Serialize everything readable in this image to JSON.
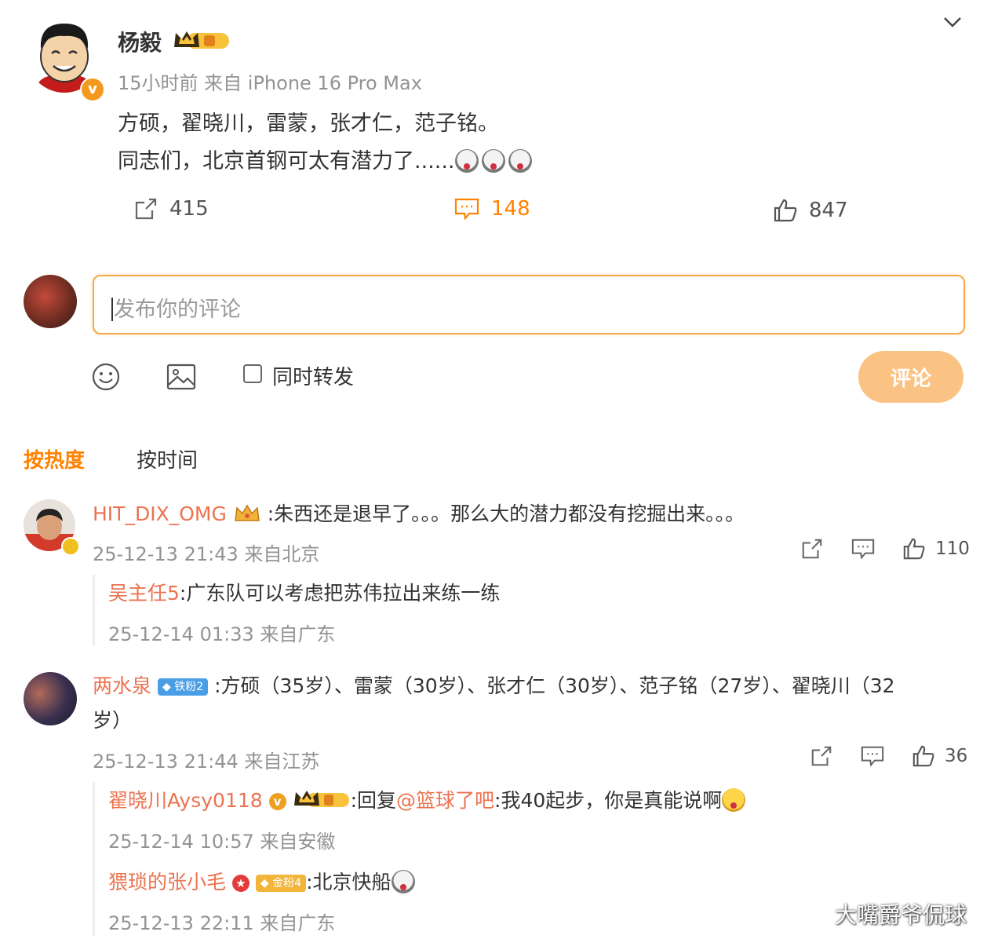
{
  "post": {
    "author": "杨毅",
    "time_source": "15小时前 来自 iPhone 16 Pro Max",
    "line1": "方硕，翟晓川，雷蒙，张才仁，范子铭。",
    "line2": "同志们，北京首钢可太有潜力了......",
    "reposts": "415",
    "comments": "148",
    "likes": "847"
  },
  "composer": {
    "placeholder": "发布你的评论",
    "repost_label": "同时转发",
    "submit_label": "评论"
  },
  "sort": {
    "hot": "按热度",
    "time": "按时间"
  },
  "comments": [
    {
      "name": "HIT_DIX_OMG",
      "text": ":朱西还是退早了。。。那么大的潜力都没有挖掘出来。。。",
      "meta": "25-12-13 21:43 来自北京",
      "likes": "110",
      "replies": [
        {
          "name": "吴主任5",
          "text": ":广东队可以考虑把苏伟拉出来练一练",
          "meta": "25-12-14 01:33 来自广东"
        }
      ]
    },
    {
      "name": "两水泉",
      "badge": "铁粉2",
      "text": ":方硕（35岁）、雷蒙（30岁）、张才仁（30岁）、范子铭（27岁）、翟晓川（32",
      "text2": "岁）",
      "meta": "25-12-13 21:44 来自江苏",
      "likes": "36",
      "replies": [
        {
          "name": "翟晓川Aysy0118",
          "prefix": ":回复",
          "mention": "@篮球了吧",
          "text": ":我40起步，你是真能说啊",
          "meta": "25-12-14 10:57 来自安徽"
        },
        {
          "name": "猥琐的张小毛",
          "badge": "金粉4",
          "text": ":北京快船",
          "meta": "25-12-13 22:11 来自广东"
        }
      ]
    }
  ],
  "watermark": "大嘴爵爷侃球",
  "colors": {
    "accent": "#ff8200",
    "username": "#eb7350",
    "input_border": "#f6a94a",
    "submit_bg": "#fbc383"
  }
}
